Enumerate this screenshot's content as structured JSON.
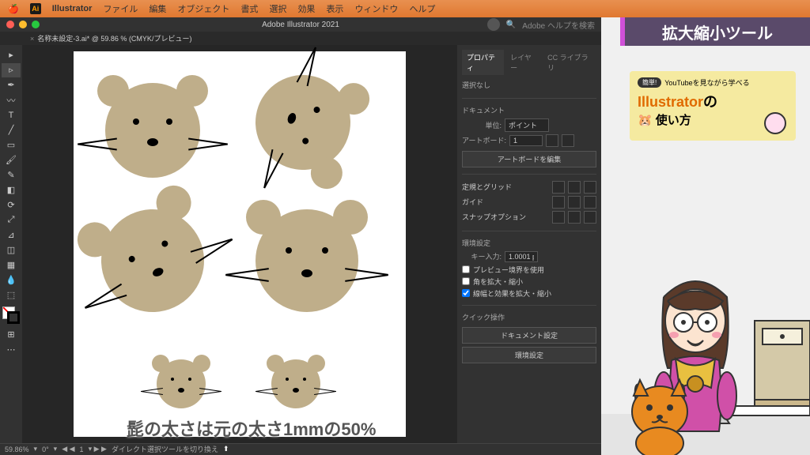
{
  "menubar": {
    "app": "Illustrator",
    "items": [
      "ファイル",
      "編集",
      "オブジェクト",
      "書式",
      "選択",
      "効果",
      "表示",
      "ウィンドウ",
      "ヘルプ"
    ]
  },
  "window": {
    "title": "Adobe Illustrator 2021",
    "search_placeholder": "Adobe ヘルプを検索"
  },
  "doc_tab": "名称未設定-3.ai* @ 59.86 % (CMYK/プレビュー)",
  "panels": {
    "tabs": [
      "プロパティ",
      "レイヤー",
      "CC ライブラリ"
    ],
    "selection": "選択なし",
    "document": {
      "label": "ドキュメント",
      "unit_label": "単位:",
      "unit_value": "ポイント",
      "artboard_label": "アートボード:",
      "artboard_value": "1",
      "edit_btn": "アートボードを編集"
    },
    "ruler_grid": "定規とグリッド",
    "guides": "ガイド",
    "snap": "スナップオプション",
    "prefs": {
      "label": "環境設定",
      "key_label": "キー入力:",
      "key_value": "1.0001 p",
      "cb_preview": "プレビュー境界を使用",
      "cb_corners": "角を拡大・縮小",
      "cb_strokes": "線幅と効果を拡大・縮小"
    },
    "quick": {
      "label": "クイック操作",
      "btn_doc": "ドキュメント設定",
      "btn_pref": "環境設定"
    }
  },
  "status": {
    "zoom": "59.86%",
    "rotate": "0°",
    "page": "1",
    "hint": "ダイレクト選択ツールを切り換え"
  },
  "caption": "髭の太さは元の太さ1mmの50%",
  "overlay": {
    "title": "拡大縮小ツール",
    "promo_badge": "簡単!",
    "promo_top": "YouTubeを見ながら学べる",
    "promo_brand": "Illustrator",
    "promo_brand_suffix": "の",
    "promo_sub": "使い方"
  }
}
